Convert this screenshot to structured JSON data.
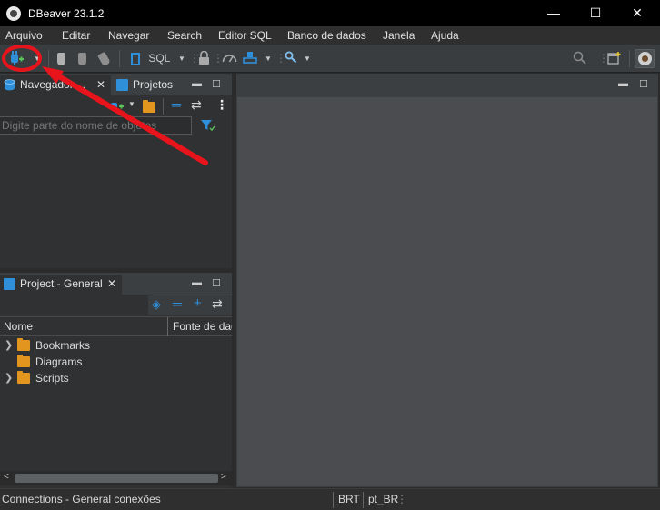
{
  "window": {
    "title": "DBeaver 23.1.2",
    "minimize": "—",
    "maximize": "☐",
    "close": "✕"
  },
  "menu": [
    "Arquivo",
    "Editar",
    "Navegar",
    "Search",
    "Editor SQL",
    "Banco de dados",
    "Janela",
    "Ajuda"
  ],
  "toolbar": {
    "sql_label": "SQL"
  },
  "navigator": {
    "tab_navigator": "Navegador ...",
    "tab_projects": "Projetos",
    "filter_placeholder": "Digite parte do nome de objetos"
  },
  "project": {
    "tab_label": "Project - General",
    "col_name": "Nome",
    "col_datasource": "Fonte de dad",
    "items": [
      "Bookmarks",
      "Diagrams",
      "Scripts"
    ]
  },
  "status": {
    "left": "Connections - General conexões",
    "timezone": "BRT",
    "locale": "pt_BR"
  },
  "colors": {
    "accent_blue": "#2f8fd8",
    "folder_orange": "#e3961f",
    "annotation_red": "#e8141c"
  }
}
